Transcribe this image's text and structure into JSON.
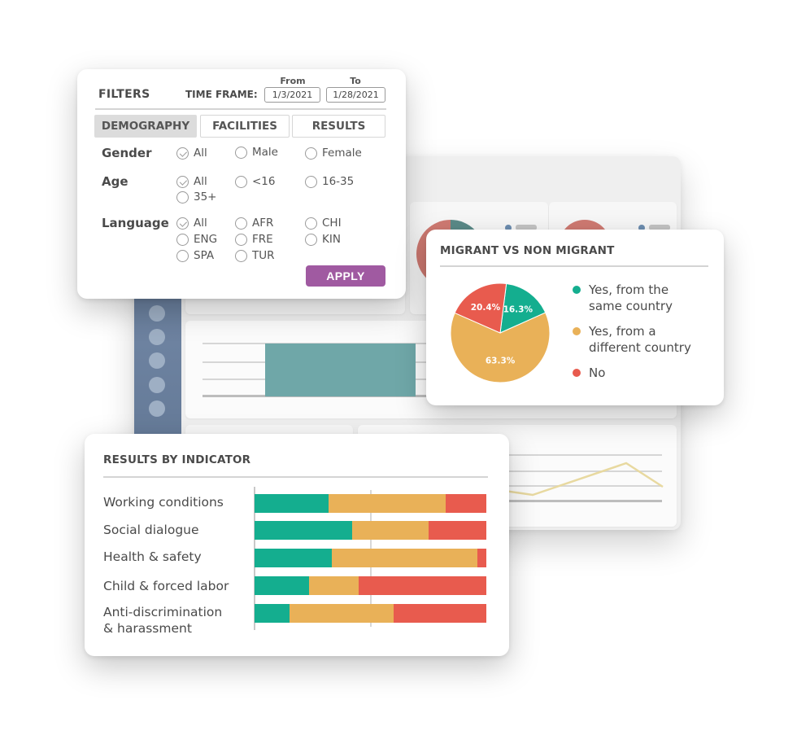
{
  "colors": {
    "green": "#14ae8f",
    "orange": "#e9b158",
    "red": "#e85b4e",
    "apply": "#a05aa1",
    "dash_sidebar": "#647a98",
    "dash_teal": "#6fa7a8",
    "dash_line": "#e8d9a0"
  },
  "filters": {
    "title": "FILTERS",
    "time_frame_label": "TIME FRAME:",
    "from_label": "From",
    "to_label": "To",
    "from_value": "1/3/2021",
    "to_value": "1/28/2021",
    "tabs": [
      {
        "label": "DEMOGRAPHY",
        "active": true
      },
      {
        "label": "FACILITIES",
        "active": false
      },
      {
        "label": "RESULTS",
        "active": false
      }
    ],
    "groups": [
      {
        "label": "Gender",
        "options": [
          {
            "label": "All",
            "checked": true
          },
          {
            "label": "Male",
            "checked": false
          },
          {
            "label": "Female",
            "checked": false
          }
        ]
      },
      {
        "label": "Age",
        "options": [
          {
            "label": "All",
            "checked": true
          },
          {
            "label": "<16",
            "checked": false
          },
          {
            "label": "16-35",
            "checked": false
          },
          {
            "label": "35+",
            "checked": false
          }
        ]
      },
      {
        "label": "Language",
        "options": [
          {
            "label": "All",
            "checked": true
          },
          {
            "label": "AFR",
            "checked": false
          },
          {
            "label": "CHI",
            "checked": false
          },
          {
            "label": "ENG",
            "checked": false
          },
          {
            "label": "FRE",
            "checked": false
          },
          {
            "label": "KIN",
            "checked": false
          },
          {
            "label": "SPA",
            "checked": false
          },
          {
            "label": "TUR",
            "checked": false
          }
        ]
      }
    ],
    "apply_label": "APPLY"
  },
  "migrant": {
    "title": "MIGRANT VS NON MIGRANT",
    "slices": [
      {
        "label": "Yes, from the same country",
        "line1": "Yes, from the",
        "line2": "same country",
        "value": 16.3,
        "display": "16.3%",
        "color": "#14ae8f"
      },
      {
        "label": "Yes, from a different country",
        "line1": "Yes, from a",
        "line2": "different country",
        "value": 63.3,
        "display": "63.3%",
        "color": "#e9b158"
      },
      {
        "label": "No",
        "line1": "No",
        "line2": "",
        "value": 20.4,
        "display": "20.4%",
        "color": "#e85b4e"
      }
    ]
  },
  "results": {
    "title": "RESULTS BY INDICATOR",
    "rows": [
      {
        "label": "Working conditions",
        "green": 32,
        "orange": 50.5,
        "red": 17.5
      },
      {
        "label": "Social dialogue",
        "green": 42,
        "orange": 33,
        "red": 25
      },
      {
        "label": "Health & safety",
        "green": 33.5,
        "orange": 62.5,
        "red": 4
      },
      {
        "label": "Child & forced labor",
        "green": 23.5,
        "orange": 21.5,
        "red": 55
      },
      {
        "label": "Anti-discrimination & harassment",
        "line1": "Anti-discrimination",
        "line2": "& harassment",
        "green": 15,
        "orange": 45,
        "red": 40
      }
    ]
  },
  "chart_data": [
    {
      "type": "pie",
      "title": "MIGRANT VS NON MIGRANT",
      "categories": [
        "Yes, from the same country",
        "Yes, from a different country",
        "No"
      ],
      "values": [
        16.3,
        63.3,
        20.4
      ],
      "data_labels": [
        "16.3%",
        "63.3%",
        "20.4%"
      ],
      "colors": [
        "#14ae8f",
        "#e9b158",
        "#e85b4e"
      ],
      "legend": "right"
    },
    {
      "type": "bar",
      "orientation": "horizontal",
      "stacked": true,
      "title": "RESULTS BY INDICATOR",
      "categories": [
        "Working conditions",
        "Social dialogue",
        "Health & safety",
        "Child & forced labor",
        "Anti-discrimination & harassment"
      ],
      "series": [
        {
          "name": "green",
          "color": "#14ae8f",
          "values": [
            32,
            42,
            33.5,
            23.5,
            15
          ]
        },
        {
          "name": "orange",
          "color": "#e9b158",
          "values": [
            50.5,
            33,
            62.5,
            21.5,
            45
          ]
        },
        {
          "name": "red",
          "color": "#e85b4e",
          "values": [
            17.5,
            25,
            4,
            55,
            40
          ]
        }
      ],
      "xlim": [
        0,
        100
      ],
      "reference_line": 50
    }
  ]
}
